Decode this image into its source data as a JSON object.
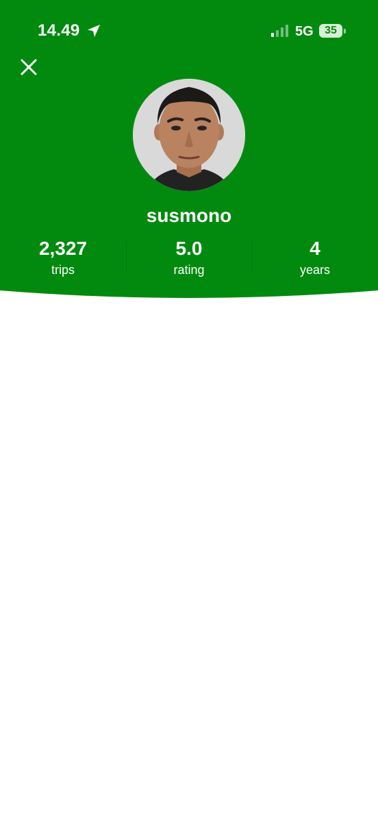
{
  "status_bar": {
    "time": "14.49",
    "network": "5G",
    "battery": "35"
  },
  "profile": {
    "name": "susmono",
    "stats": [
      {
        "value": "2,327",
        "label": "trips"
      },
      {
        "value": "5.0",
        "label": "rating"
      },
      {
        "value": "4",
        "label": "years"
      }
    ]
  },
  "colors": {
    "header_green": "#028a0f",
    "text_white": "#ffffff",
    "background": "#ffffff"
  },
  "icons": {
    "close": "close-icon",
    "location": "location-arrow-icon",
    "signal": "cellular-signal-icon",
    "avatar": "driver-photo"
  }
}
